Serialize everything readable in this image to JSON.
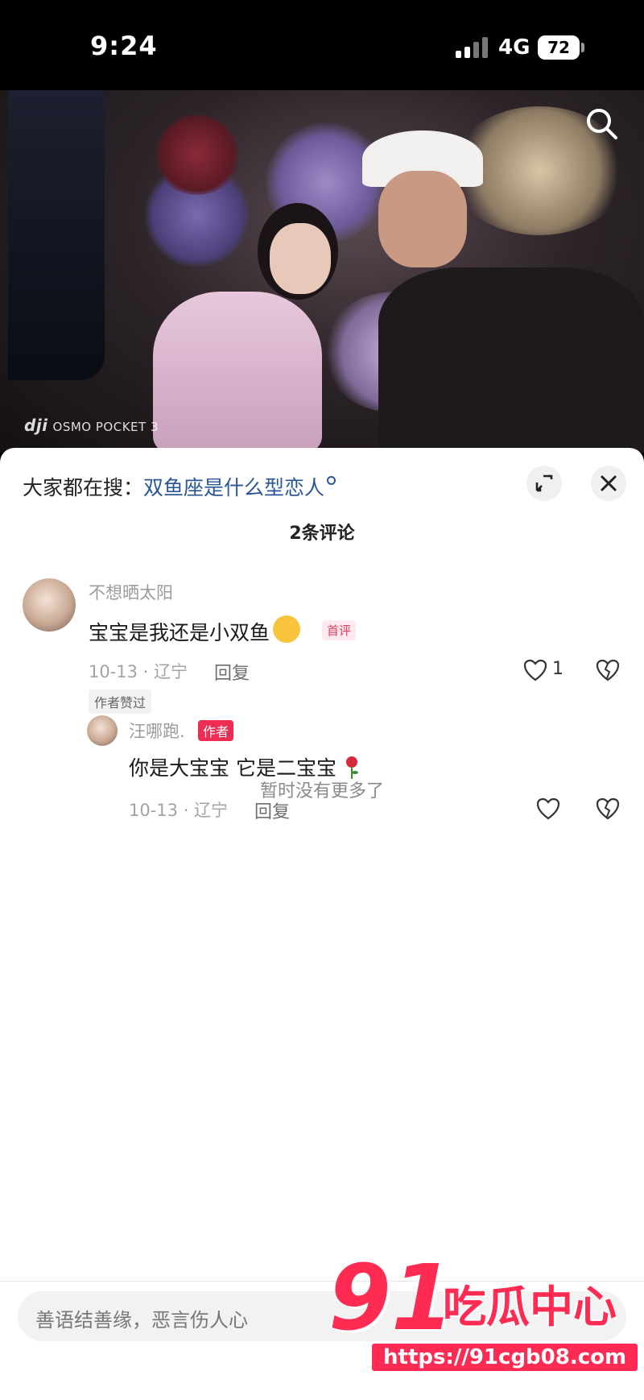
{
  "status_bar": {
    "time": "9:24",
    "network": "4G",
    "battery": "72"
  },
  "video": {
    "watermark_brand": "dji",
    "watermark_model": "OSMO POCKET 3"
  },
  "search_hint": {
    "label": "大家都在搜：",
    "query": "双鱼座是什么型恋人"
  },
  "comments_header": {
    "count_text": "2条评论"
  },
  "comments": [
    {
      "username": "不想晒太阳",
      "text": "宝宝是我还是小双鱼",
      "badge": "首评",
      "date": "10-13 · 辽宁",
      "reply_label": "回复",
      "likes": "1",
      "author_liked": "作者赞过",
      "replies": [
        {
          "username": "汪哪跑.",
          "badge": "作者",
          "text": "你是大宝宝 它是二宝宝",
          "date": "10-13 · 辽宁",
          "reply_label": "回复"
        }
      ]
    }
  ],
  "end_text": "暂时没有更多了",
  "input": {
    "placeholder": "善语结善缘，恶言伤人心"
  },
  "overlay_watermark": {
    "number": "91",
    "text": "吃瓜中心",
    "url": "https://91cgb08.com"
  },
  "colors": {
    "accent": "#ee2d55",
    "link": "#2a5696"
  }
}
